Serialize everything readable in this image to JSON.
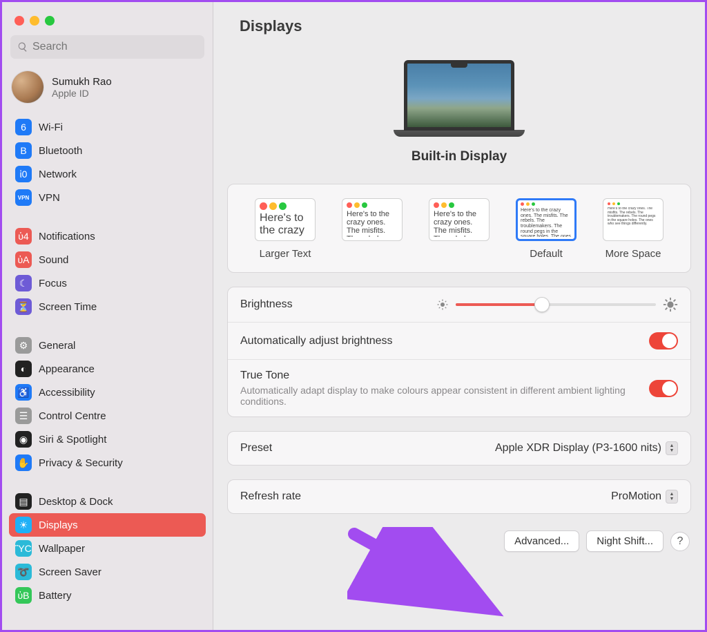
{
  "page_title": "Displays",
  "search": {
    "placeholder": "Search"
  },
  "user": {
    "name": "Sumukh Rao",
    "sub": "Apple ID"
  },
  "sidebar": {
    "groups": [
      [
        {
          "label": "Wi-Fi",
          "icon": "wifi",
          "bg": "#1f7af7"
        },
        {
          "label": "Bluetooth",
          "icon": "bluetooth",
          "bg": "#1f7af7"
        },
        {
          "label": "Network",
          "icon": "network",
          "bg": "#1f7af7"
        },
        {
          "label": "VPN",
          "icon": "vpn",
          "bg": "#1f7af7"
        }
      ],
      [
        {
          "label": "Notifications",
          "icon": "bell",
          "bg": "#ec5a54"
        },
        {
          "label": "Sound",
          "icon": "sound",
          "bg": "#ec5a54"
        },
        {
          "label": "Focus",
          "icon": "focus",
          "bg": "#6e5bd6"
        },
        {
          "label": "Screen Time",
          "icon": "hourglass",
          "bg": "#6e5bd6"
        }
      ],
      [
        {
          "label": "General",
          "icon": "gear",
          "bg": "#9a9a9a"
        },
        {
          "label": "Appearance",
          "icon": "appearance",
          "bg": "#222"
        },
        {
          "label": "Accessibility",
          "icon": "accessibility",
          "bg": "#1f7af7"
        },
        {
          "label": "Control Centre",
          "icon": "switches",
          "bg": "#9a9a9a"
        },
        {
          "label": "Siri & Spotlight",
          "icon": "siri",
          "bg": "#222"
        },
        {
          "label": "Privacy & Security",
          "icon": "hand",
          "bg": "#1f7af7"
        }
      ],
      [
        {
          "label": "Desktop & Dock",
          "icon": "dock",
          "bg": "#222"
        },
        {
          "label": "Displays",
          "icon": "displays",
          "bg": "#1fb0f7",
          "selected": true
        },
        {
          "label": "Wallpaper",
          "icon": "wallpaper",
          "bg": "#2bbad8"
        },
        {
          "label": "Screen Saver",
          "icon": "screensaver",
          "bg": "#2bbad8"
        },
        {
          "label": "Battery",
          "icon": "battery",
          "bg": "#34c759"
        }
      ]
    ]
  },
  "display": {
    "name": "Built-in Display"
  },
  "resolution": {
    "options": [
      "Larger Text",
      "",
      "",
      "Default",
      "More Space"
    ],
    "selected_index": 3,
    "sample_text": "Here's to the crazy ones. The misfits. The rebels. The troublemakers. The round pegs in the square holes. The ones who see things differently."
  },
  "settings": {
    "brightness_label": "Brightness",
    "brightness_value": 0.43,
    "auto_brightness_label": "Automatically adjust brightness",
    "auto_brightness": true,
    "true_tone_label": "True Tone",
    "true_tone_desc": "Automatically adapt display to make colours appear consistent in different ambient lighting conditions.",
    "true_tone": true,
    "preset_label": "Preset",
    "preset_value": "Apple XDR Display (P3-1600 nits)",
    "refresh_label": "Refresh rate",
    "refresh_value": "ProMotion"
  },
  "buttons": {
    "advanced": "Advanced...",
    "night_shift": "Night Shift...",
    "help": "?"
  },
  "icon_glyphs": {
    "wifi": "὏6",
    "bluetooth": "B",
    "network": "ἱ0",
    "vpn": "VPN",
    "bell": "ὑ4",
    "sound": "ὐA",
    "focus": "☾",
    "hourglass": "⏳",
    "gear": "⚙",
    "appearance": "◐",
    "accessibility": "♿",
    "switches": "☰",
    "siri": "◉",
    "hand": "✋",
    "dock": "▤",
    "displays": "☀",
    "wallpaper": "ὛC",
    "screensaver": "➰",
    "battery": "ὐB"
  }
}
